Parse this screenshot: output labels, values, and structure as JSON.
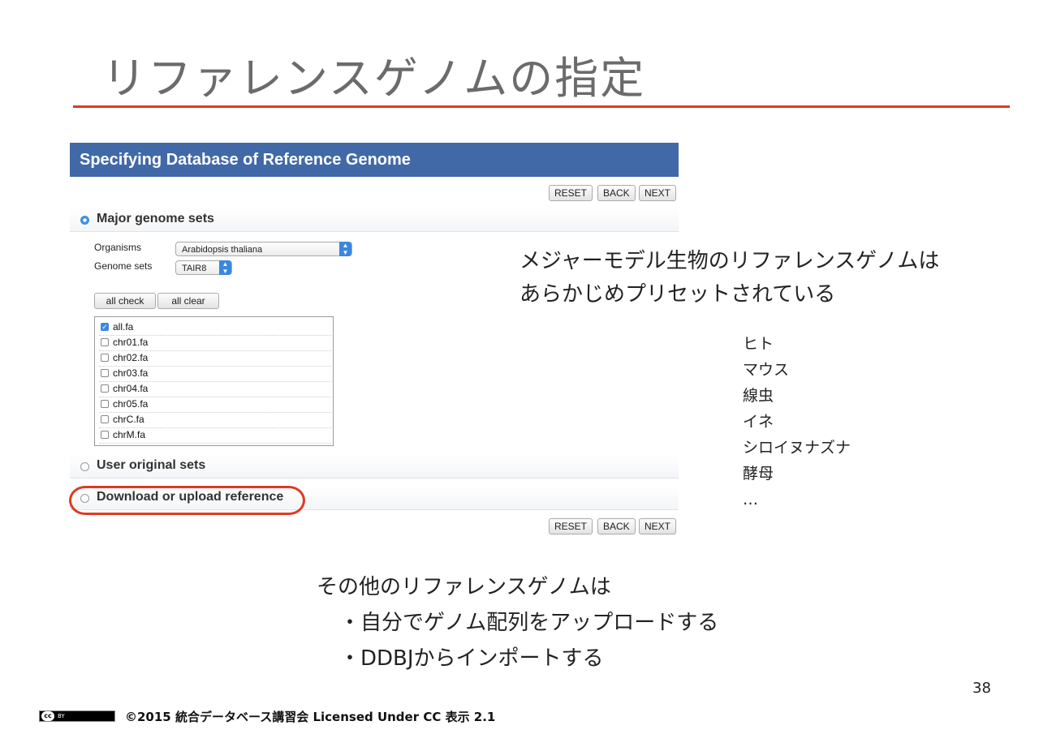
{
  "slide": {
    "title": "リファレンスゲノムの指定",
    "page_number": "38",
    "footer_text": "©2015 統合データベース講習会 Licensed Under CC 表示 2.1",
    "cc_badge": {
      "cc": "cc",
      "by": "BY"
    }
  },
  "app": {
    "header": "Specifying Database of Reference Genome",
    "buttons": {
      "reset": "RESET",
      "back": "BACK",
      "next": "NEXT"
    },
    "sections": {
      "major": "Major genome sets",
      "user": "User original sets",
      "download": "Download or upload reference"
    },
    "organisms_label": "Organisms",
    "organisms_value": "Arabidopsis thaliana",
    "genome_sets_label": "Genome sets",
    "genome_sets_value": "TAIR8",
    "all_check": "all check",
    "all_clear": "all clear",
    "files": [
      {
        "name": "all.fa",
        "checked": true
      },
      {
        "name": "chr01.fa",
        "checked": false
      },
      {
        "name": "chr02.fa",
        "checked": false
      },
      {
        "name": "chr03.fa",
        "checked": false
      },
      {
        "name": "chr04.fa",
        "checked": false
      },
      {
        "name": "chr05.fa",
        "checked": false
      },
      {
        "name": "chrC.fa",
        "checked": false
      },
      {
        "name": "chrM.fa",
        "checked": false
      }
    ]
  },
  "annotation": {
    "line1": "メジャーモデル生物のリファレンスゲノムは",
    "line2": "あらかじめプリセットされている",
    "organisms": [
      "ヒト",
      "マウス",
      "線虫",
      "イネ",
      "シロイヌナズナ",
      "酵母",
      "…"
    ]
  },
  "bottom": {
    "line1": "その他のリファレンスゲノムは",
    "line2": "・自分でゲノム配列をアップロードする",
    "line3": "・DDBJからインポートする"
  },
  "colors": {
    "title_rule": "#e0391f",
    "app_header": "#4169a8",
    "highlight": "#e03a22",
    "accent": "#3b86e0"
  }
}
